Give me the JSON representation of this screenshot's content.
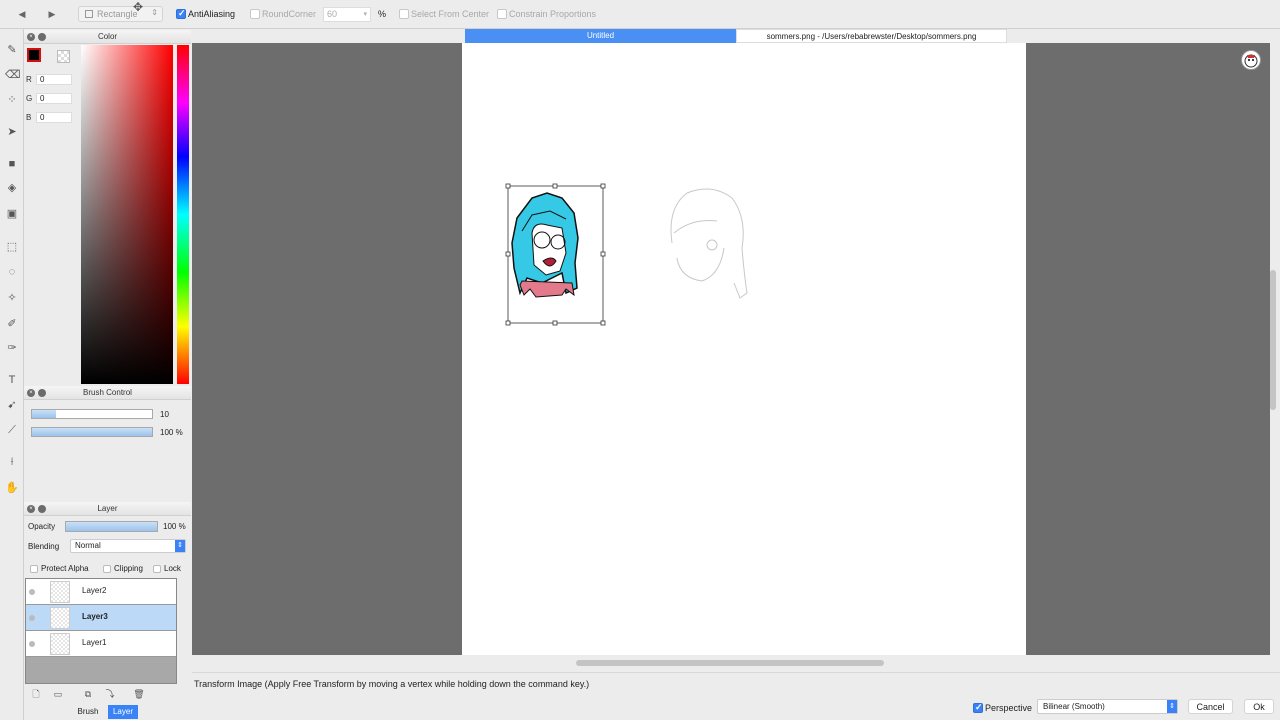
{
  "toolbar": {
    "nav_back": "◀",
    "nav_forward": "▶",
    "shape": "Rectangle",
    "antialiasing": {
      "label": "AntiAliasing",
      "checked": true
    },
    "round_corner": {
      "label": "RoundCorner",
      "checked": false,
      "value": "60",
      "unit": "%"
    },
    "select_from_center": {
      "label": "Select From Center",
      "checked": false
    },
    "constrain_proportions": {
      "label": "Constrain Proportions",
      "checked": false
    }
  },
  "tools": [
    "pen-icon",
    "eraser-icon",
    "dots-icon",
    "move-icon",
    "fill-icon",
    "bucket-icon",
    "gradient-icon",
    "select-rect-icon",
    "lasso-icon",
    "magic-wand-icon",
    "pen-tool-icon",
    "select-pen-icon",
    "text-icon",
    "operation-icon",
    "dropper-icon",
    "eyedropper-icon",
    "hand-icon"
  ],
  "color_panel": {
    "title": "Color",
    "foreground_color": "#000000",
    "r_label": "R",
    "r": "0",
    "g_label": "G",
    "g": "0",
    "b_label": "B",
    "b": "0",
    "hue_color": "#ff0000"
  },
  "brush_panel": {
    "title": "Brush Control",
    "size_value": "10",
    "size_fraction": 0.2,
    "opacity_value": "100 %",
    "opacity_fraction": 1.0
  },
  "layer_panel": {
    "title": "Layer",
    "opacity_label": "Opacity",
    "opacity_value": "100 %",
    "blending_label": "Blending",
    "blending_value": "Normal",
    "protect_alpha": "Protect Alpha",
    "clipping": "Clipping",
    "lock": "Lock",
    "layers": [
      {
        "name": "Layer2",
        "selected": false
      },
      {
        "name": "Layer3",
        "selected": true
      },
      {
        "name": "Layer1",
        "selected": false
      }
    ]
  },
  "bottom_tabs": {
    "brush": "Brush",
    "layer": "Layer",
    "active": "Layer"
  },
  "documents": {
    "active_tab": "Untitled",
    "other_tab": "sommers.png - /Users/rebabrewster/Desktop/sommers.png"
  },
  "status": {
    "message": "Transform Image (Apply Free Transform by moving a vertex while holding down the command key.)",
    "perspective_label": "Perspective",
    "perspective_checked": true,
    "interpolation": "Bilinear (Smooth)",
    "cancel": "Cancel",
    "ok": "Ok"
  },
  "colors": {
    "accent": "#3a82f7",
    "hair": "#35c9e6",
    "workspace": "#6d6d6d"
  }
}
